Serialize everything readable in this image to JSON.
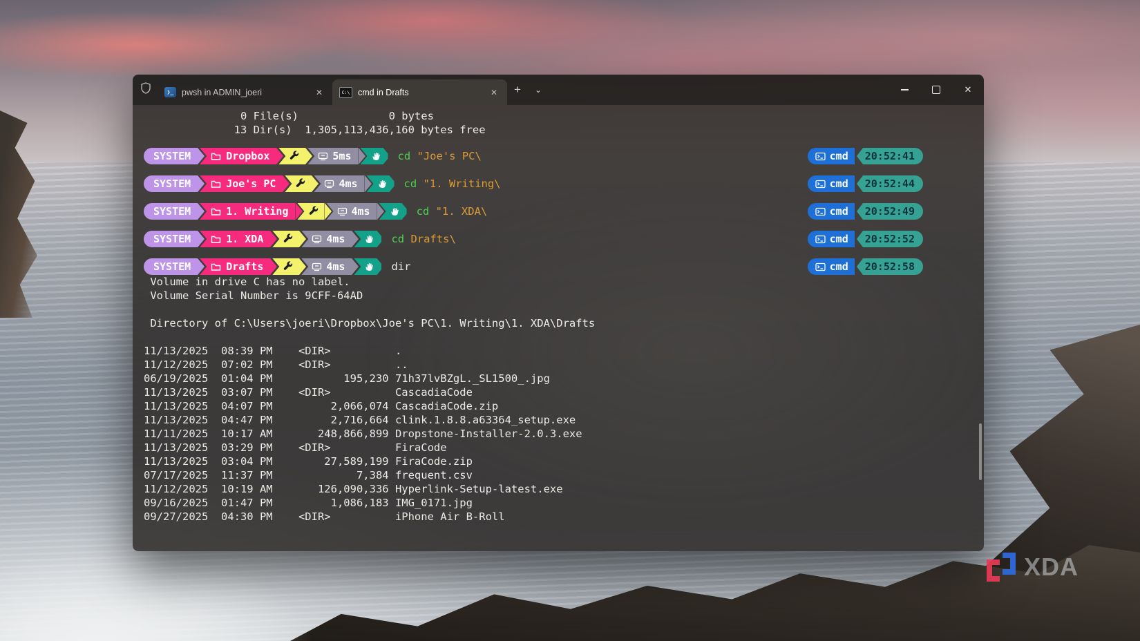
{
  "window": {
    "tabs": [
      {
        "id": "pwsh",
        "icon": "powershell",
        "label": "pwsh in ADMIN_joeri",
        "active": false
      },
      {
        "id": "cmd",
        "icon": "cmd",
        "label": "cmd in Drafts",
        "active": true
      }
    ],
    "new_tab_glyph": "+",
    "dropdown_glyph": "⌄",
    "controls": {
      "minimize_glyph": "",
      "maximize_glyph": "",
      "close_glyph": "✕"
    }
  },
  "icons": {
    "admin": "shield-icon",
    "powershell_glyph": "❯_",
    "cmd_glyph": "C:\\",
    "tab_close_glyph": "✕",
    "prompt_folder": "folder-icon",
    "prompt_tool": "wrench-icon",
    "prompt_duration": "timer-icon",
    "prompt_shell": "hand-icon",
    "badge_shell": "terminal-icon"
  },
  "colors": {
    "seg_user": "#bd94e8",
    "seg_path": "#f62b7d",
    "seg_tool": "#f4f26d",
    "seg_dur": "#918da3",
    "seg_shell": "#14a189",
    "badge_shell": "#1e70d6",
    "badge_time": "#36a294",
    "badge_time_text": "#0c333d",
    "cmd_keyword": "#4bd24f",
    "cmd_arg": "#dd9c33",
    "term_text": "#eceae6"
  },
  "terminal": {
    "pre_lines": [
      "               0 File(s)              0 bytes",
      "              13 Dir(s)  1,305,113,436,160 bytes free"
    ],
    "prompts": [
      {
        "user": "SYSTEM",
        "folder": "Dropbox",
        "duration": "5ms",
        "shell": "cmd",
        "time": "20:52:41",
        "command": [
          {
            "text": "cd",
            "style": "kw"
          },
          {
            "text": " \"Joe's PC\\",
            "style": "arg"
          }
        ]
      },
      {
        "user": "SYSTEM",
        "folder": "Joe's PC",
        "duration": "4ms",
        "shell": "cmd",
        "time": "20:52:44",
        "command": [
          {
            "text": "cd",
            "style": "kw"
          },
          {
            "text": " \"1. Writing\\",
            "style": "arg"
          }
        ]
      },
      {
        "user": "SYSTEM",
        "folder": "1. Writing",
        "duration": "4ms",
        "shell": "cmd",
        "time": "20:52:49",
        "command": [
          {
            "text": "cd",
            "style": "kw"
          },
          {
            "text": " \"1. XDA\\",
            "style": "arg"
          }
        ]
      },
      {
        "user": "SYSTEM",
        "folder": "1. XDA",
        "duration": "4ms",
        "shell": "cmd",
        "time": "20:52:52",
        "command": [
          {
            "text": "cd",
            "style": "kw"
          },
          {
            "text": " Drafts\\",
            "style": "arg"
          }
        ]
      },
      {
        "user": "SYSTEM",
        "folder": "Drafts",
        "duration": "4ms",
        "shell": "cmd",
        "time": "20:52:58",
        "command": [
          {
            "text": "dir",
            "style": "plain"
          }
        ]
      }
    ],
    "post_lines": [
      " Volume in drive C has no label.",
      " Volume Serial Number is 9CFF-64AD",
      "",
      " Directory of C:\\Users\\joeri\\Dropbox\\Joe's PC\\1. Writing\\1. XDA\\Drafts",
      "",
      "11/13/2025  08:39 PM    <DIR>          .",
      "11/12/2025  07:02 PM    <DIR>          ..",
      "06/19/2025  01:04 PM           195,230 71h37lvBZgL._SL1500_.jpg",
      "11/13/2025  03:07 PM    <DIR>          CascadiaCode",
      "11/13/2025  04:07 PM         2,066,074 CascadiaCode.zip",
      "11/13/2025  04:47 PM         2,716,664 clink.1.8.8.a63364_setup.exe",
      "11/11/2025  10:17 AM       248,866,899 Dropstone-Installer-2.0.3.exe",
      "11/13/2025  03:29 PM    <DIR>          FiraCode",
      "11/13/2025  03:04 PM        27,589,199 FiraCode.zip",
      "07/17/2025  11:37 PM             7,384 frequent.csv",
      "11/12/2025  10:19 AM       126,090,336 Hyperlink-Setup-latest.exe",
      "09/16/2025  01:47 PM         1,086,183 IMG_0171.jpg",
      "09/27/2025  04:30 PM    <DIR>          iPhone Air B-Roll"
    ]
  },
  "watermark": {
    "brand": "XDA"
  }
}
